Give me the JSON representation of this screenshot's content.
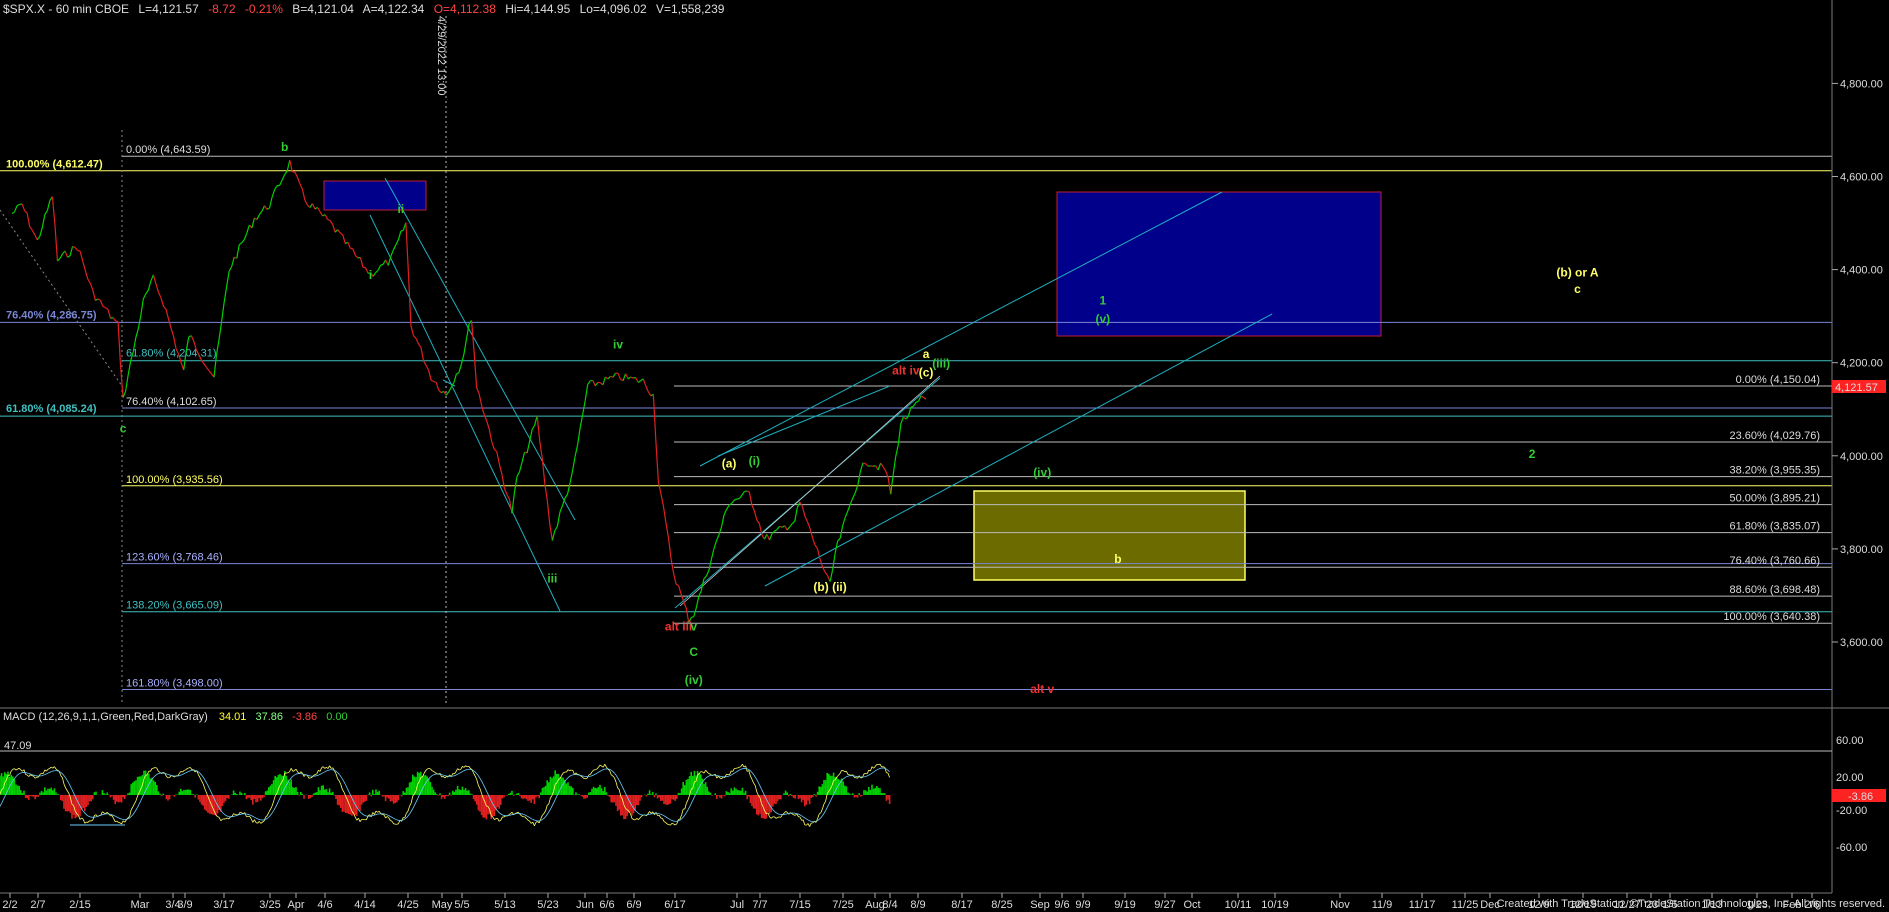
{
  "header": {
    "symbol": "$SPX.X - 60 min  CBOE",
    "last": "L=4,121.57",
    "chg": "-8.72",
    "pct": "-0.21%",
    "bid": "B=4,121.04",
    "ask": "A=4,122.34",
    "open": "O=4,112.38",
    "high": "Hi=4,144.95",
    "low": "Lo=4,096.02",
    "vol": "V=1,558,239"
  },
  "cursor_date": "4/29/2022 13:00",
  "last_price_tag": "4,121.57",
  "footer_credit": "Created with TradeStation. ©TradeStation Technologies, Inc. All rights reserved.",
  "macd": {
    "title": "MACD (12,26,9,1,1,Green,Red,DarkGray)",
    "v1": "34.01",
    "v2": "37.86",
    "v3": "-3.86",
    "v4": "0.00",
    "level_label": "47.09",
    "axis": [
      "60.00",
      "20.00",
      "-20.00",
      "-60.00"
    ],
    "current_tag": "-3.86"
  },
  "colors": {
    "bg": "#000000",
    "up": "#00d000",
    "down": "#e02020",
    "fib": "#7a86d8",
    "yellow": "#ffff66",
    "wave_green": "#33cc33",
    "wave_red": "#ee3333",
    "channel": "#20b0c0",
    "blue_box": "#00008b",
    "yellow_box": "#6b6b00"
  },
  "chart_data": {
    "type": "line",
    "title": "",
    "xlabel": "",
    "ylabel": "",
    "ylim": [
      3450,
      4900
    ],
    "y_ticks": [
      3600,
      3800,
      4000,
      4200,
      4400,
      4600,
      4800
    ],
    "y_tick_labels": [
      "3,600.00",
      "3,800.00",
      "4,000.00",
      "4,200.00",
      "4,400.00",
      "4,600.00",
      "4,800.00"
    ],
    "x_tick_labels": [
      "2/2",
      "2/7",
      "2/15",
      "Mar",
      "3/4",
      "3/9",
      "3/17",
      "3/25",
      "Apr",
      "4/6",
      "4/14",
      "4/25",
      "May",
      "5/5",
      "5/13",
      "5/23",
      "Jun",
      "6/6",
      "6/9",
      "6/17",
      "Jul",
      "7/7",
      "7/15",
      "7/25",
      "Aug",
      "8/4",
      "8/9",
      "8/17",
      "8/25",
      "Sep",
      "9/6",
      "9/9",
      "9/19",
      "9/27",
      "Oct",
      "10/11",
      "10/19",
      "Nov",
      "11/9",
      "11/17",
      "11/25",
      "Dec",
      "12/9",
      "12/19",
      "12/27",
      "'23",
      "1/5",
      "1/13",
      "1/23",
      "Feb",
      "2/6"
    ],
    "price_path": [
      [
        "2/2",
        4520
      ],
      [
        "2/4",
        4540
      ],
      [
        "2/7",
        4460
      ],
      [
        "2/10",
        4560
      ],
      [
        "2/11",
        4420
      ],
      [
        "2/15",
        4450
      ],
      [
        "2/18",
        4350
      ],
      [
        "2/23",
        4280
      ],
      [
        "2/24",
        4120
      ],
      [
        "2/28",
        4330
      ],
      [
        "3/2",
        4380
      ],
      [
        "3/4",
        4330
      ],
      [
        "3/8",
        4180
      ],
      [
        "3/9",
        4260
      ],
      [
        "3/14",
        4170
      ],
      [
        "3/17",
        4400
      ],
      [
        "3/22",
        4510
      ],
      [
        "3/25",
        4540
      ],
      [
        "3/29",
        4630
      ],
      [
        "4/1",
        4550
      ],
      [
        "4/6",
        4500
      ],
      [
        "4/11",
        4430
      ],
      [
        "4/14",
        4390
      ],
      [
        "4/18",
        4420
      ],
      [
        "4/21",
        4500
      ],
      [
        "4/22",
        4280
      ],
      [
        "4/26",
        4170
      ],
      [
        "4/29",
        4130
      ],
      [
        "5/2",
        4200
      ],
      [
        "5/4",
        4300
      ],
      [
        "5/5",
        4150
      ],
      [
        "5/9",
        4000
      ],
      [
        "5/12",
        3880
      ],
      [
        "5/13",
        3950
      ],
      [
        "5/17",
        4080
      ],
      [
        "5/19",
        3900
      ],
      [
        "5/20",
        3820
      ],
      [
        "5/24",
        3960
      ],
      [
        "5/27",
        4150
      ],
      [
        "6/2",
        4170
      ],
      [
        "6/7",
        4160
      ],
      [
        "6/9",
        4130
      ],
      [
        "6/10",
        3950
      ],
      [
        "6/13",
        3750
      ],
      [
        "6/16",
        3650
      ],
      [
        "6/17",
        3660
      ],
      [
        "6/24",
        3900
      ],
      [
        "6/28",
        3920
      ],
      [
        "7/1",
        3820
      ],
      [
        "7/7",
        3860
      ],
      [
        "7/8",
        3900
      ],
      [
        "7/14",
        3720
      ],
      [
        "7/15",
        3790
      ],
      [
        "7/19",
        3930
      ],
      [
        "7/21",
        3990
      ],
      [
        "7/25",
        3970
      ],
      [
        "7/26",
        3920
      ],
      [
        "7/28",
        4070
      ],
      [
        "8/1",
        4120
      ],
      [
        "8/2",
        4121.57
      ]
    ],
    "fib_levels": [
      {
        "label": "0.00% (4,643.59)",
        "value": 4643.59
      },
      {
        "label": "100.00% (4,612.47)",
        "value": 4612.47
      },
      {
        "label": "76.40% (4,286.75)",
        "value": 4286.75
      },
      {
        "label": "61.80% (4,204.31)",
        "value": 4204.31
      },
      {
        "label": "76.40% (4,102.65)",
        "value": 4102.65
      },
      {
        "label": "61.80% (4,085.24)",
        "value": 4085.24
      },
      {
        "label": "100.00% (3,935.56)",
        "value": 3935.56
      },
      {
        "label": "123.60% (3,768.46)",
        "value": 3768.46
      },
      {
        "label": "138.20% (3,665.09)",
        "value": 3665.09
      },
      {
        "label": "161.80% (3,498.00)",
        "value": 3498.0
      },
      {
        "label": "0.00% (4,150.04)",
        "value": 4150.04
      },
      {
        "label": "23.60% (4,029.76)",
        "value": 4029.76
      },
      {
        "label": "38.20% (3,955.35)",
        "value": 3955.35
      },
      {
        "label": "50.00% (3,895.21)",
        "value": 3895.21
      },
      {
        "label": "61.80% (3,835.07)",
        "value": 3835.07
      },
      {
        "label": "76.40% (3,760.66)",
        "value": 3760.66
      },
      {
        "label": "88.60% (3,698.48)",
        "value": 3698.48
      },
      {
        "label": "100.00% (3,640.38)",
        "value": 3640.38
      }
    ],
    "wave_labels": [
      {
        "text": "b",
        "color": "wave_green",
        "date": "3/28",
        "price": 4655
      },
      {
        "text": "ii",
        "color": "wave_green",
        "date": "4/20",
        "price": 4522
      },
      {
        "text": "i",
        "color": "wave_green",
        "date": "4/14",
        "price": 4380
      },
      {
        "text": "iv",
        "color": "wave_green",
        "date": "6/2",
        "price": 4230
      },
      {
        "text": "iii",
        "color": "wave_green",
        "date": "5/20",
        "price": 3728
      },
      {
        "text": "c",
        "color": "wave_green",
        "date": "2/24",
        "price": 4050
      },
      {
        "text": "alt iii",
        "color": "wave_red",
        "date": "6/14",
        "price": 3625
      },
      {
        "text": "v",
        "color": "wave_green",
        "date": "6/17",
        "price": 3625
      },
      {
        "text": "C",
        "color": "wave_green",
        "date": "6/17",
        "price": 3570
      },
      {
        "text": "(iv)",
        "color": "wave_green",
        "date": "6/17",
        "price": 3510
      },
      {
        "text": "(a)",
        "color": "yellow",
        "date": "6/24",
        "price": 3975
      },
      {
        "text": "(i)",
        "color": "wave_green",
        "date": "6/29",
        "price": 3980
      },
      {
        "text": "(b) (ii)",
        "color": "yellow",
        "date": "7/14",
        "price": 3710
      },
      {
        "text": "alt iv",
        "color": "wave_red",
        "date": "7/29",
        "price": 4175
      },
      {
        "text": "a",
        "color": "yellow",
        "date": "8/2",
        "price": 4210
      },
      {
        "text": "(c)",
        "color": "yellow",
        "date": "8/2",
        "price": 4170
      },
      {
        "text": "(iii)",
        "color": "wave_green",
        "date": "8/5",
        "price": 4190
      },
      {
        "text": "1",
        "color": "wave_green",
        "date": "9/6",
        "price": 4325
      },
      {
        "text": "(v)",
        "color": "wave_green",
        "date": "9/6",
        "price": 4285
      },
      {
        "text": "(iv)",
        "color": "wave_green",
        "date": "8/25",
        "price": 3955
      },
      {
        "text": "b",
        "color": "yellow",
        "date": "9/9",
        "price": 3770
      },
      {
        "text": "alt v",
        "color": "wave_red",
        "date": "8/25",
        "price": 3490
      },
      {
        "text": "2",
        "color": "wave_green",
        "date": "11/30",
        "price": 3995
      },
      {
        "text": "(b) or A",
        "color": "yellow",
        "date": "12/9",
        "price": 4385
      },
      {
        "text": "c",
        "color": "yellow",
        "date": "12/9",
        "price": 4350
      }
    ],
    "grid": false
  }
}
